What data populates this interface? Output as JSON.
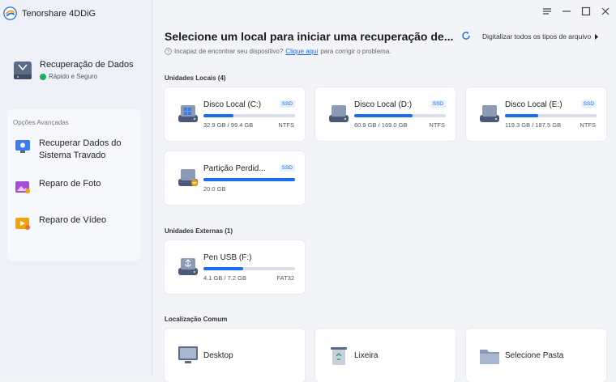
{
  "app": {
    "title": "Tenorshare 4DDiG"
  },
  "sidebar": {
    "primary": {
      "label": "Recuperação de Dados",
      "sublabel": "Rápido e Seguro"
    },
    "advanced_title": "Opções Avançadas",
    "advanced_items": [
      {
        "label": "Recuperar Dados do Sistema Travado"
      },
      {
        "label": "Reparo de Foto"
      },
      {
        "label": "Reparo de Vídeo"
      }
    ]
  },
  "header": {
    "title": "Selecione um local para iniciar uma recuperação de...",
    "scan_all": "Digitalizar todos os tipos de arquivo",
    "hint_prefix": "Incapaz de encontrar seu dispositivo?",
    "hint_link": "Clique aqui",
    "hint_suffix": "para corrigir o problema."
  },
  "sections": {
    "local": "Unidades Locais (4)",
    "external": "Unidades Externas (1)",
    "common": "Localização Comum"
  },
  "local_drives": [
    {
      "name": "Disco Local (C:)",
      "badge": "SSD",
      "size": "32.9 GB / 99.4 GB",
      "fs": "NTFS",
      "used": 0.33
    },
    {
      "name": "Disco Local (D:)",
      "badge": "SSD",
      "size": "60.9 GB / 169.0 GB",
      "fs": "NTFS",
      "used": 0.64
    },
    {
      "name": "Disco Local (E:)",
      "badge": "SSD",
      "size": "119.3 GB / 187.5 GB",
      "fs": "NTFS",
      "used": 0.36
    },
    {
      "name": "Partição Perdid...",
      "badge": "SSD",
      "size": "20.0 GB",
      "fs": "",
      "used": 1.0
    }
  ],
  "external_drives": [
    {
      "name": "Pen USB (F:)",
      "size": "4.1 GB / 7.2 GB",
      "fs": "FAT32",
      "used": 0.43
    }
  ],
  "common_locations": [
    {
      "name": "Desktop",
      "icon": "monitor-icon"
    },
    {
      "name": "Lixeira",
      "icon": "recycle-bin-icon"
    },
    {
      "name": "Selecione Pasta",
      "icon": "folder-icon"
    }
  ],
  "colors": {
    "accent": "#1a6df0",
    "bar_track": "#d9dde5",
    "background": "#f2f4f8"
  }
}
